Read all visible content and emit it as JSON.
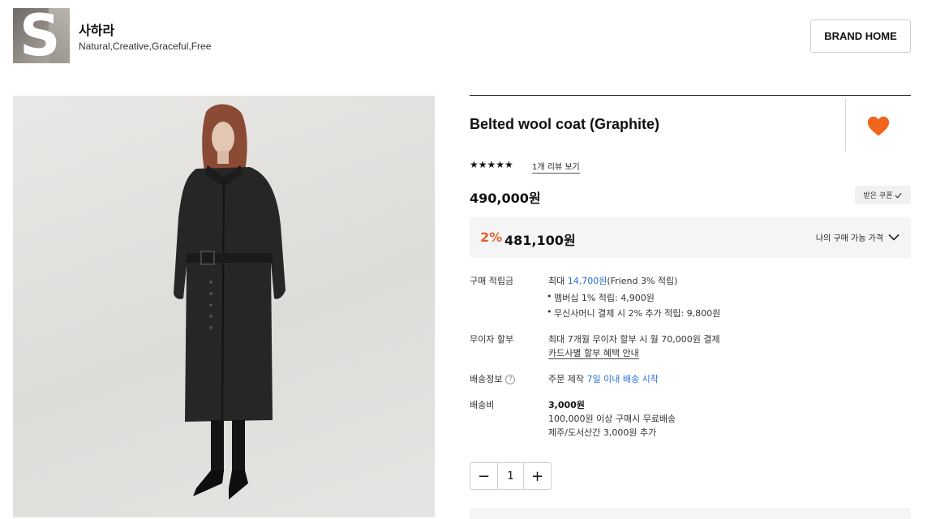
{
  "brand": {
    "logo_letter": "S",
    "name": "사하라",
    "tagline": "Natural,Creative,Graceful,Free",
    "home_button": "BRAND HOME"
  },
  "product": {
    "title": "Belted wool coat (Graphite)",
    "liked": true,
    "rating_stars": "★★★★★",
    "review_link": "1개 리뷰 보기",
    "price": "490,000원",
    "coupon_label": "받은 쿠폰",
    "discount_rate": "2%",
    "discount_price": "481,100원",
    "my_price_label": "나의 구매 가능 가격",
    "quantity": "1",
    "qty_minus": "−",
    "qty_plus": "+"
  },
  "details": {
    "points": {
      "label": "구매 적립금",
      "line_prefix": "최대 ",
      "line_amount": "14,700원",
      "line_suffix": "(Friend 3% 적립)",
      "bullets": [
        "멤버십 1% 적립: 4,900원",
        "무신사머니 결제 시 2% 추가 적립: 9,800원"
      ]
    },
    "installment": {
      "label": "무이자 할부",
      "text": "최대 7개월 무이자 할부 시 월 70,000원 결제",
      "link": "카드사별 할부 혜택 안내"
    },
    "shipping_info": {
      "label": "배송정보",
      "help_icon": "?",
      "prefix": "주문 제작 ",
      "highlight": "7일 이내 배송 시작"
    },
    "shipping_fee": {
      "label": "배송비",
      "amount": "3,000원",
      "free_line": "100,000원 이상 구매시 무료배송",
      "island_line": "제주/도서산간 3,000원 추가"
    }
  },
  "colors": {
    "accent_orange": "#e0612a",
    "heart": "#f2651f",
    "link_blue": "#2a6fd6"
  },
  "icons": [
    "heart-icon",
    "check-icon",
    "chevron-down-icon",
    "help-circle-icon",
    "minus-icon",
    "plus-icon",
    "star-icon"
  ]
}
